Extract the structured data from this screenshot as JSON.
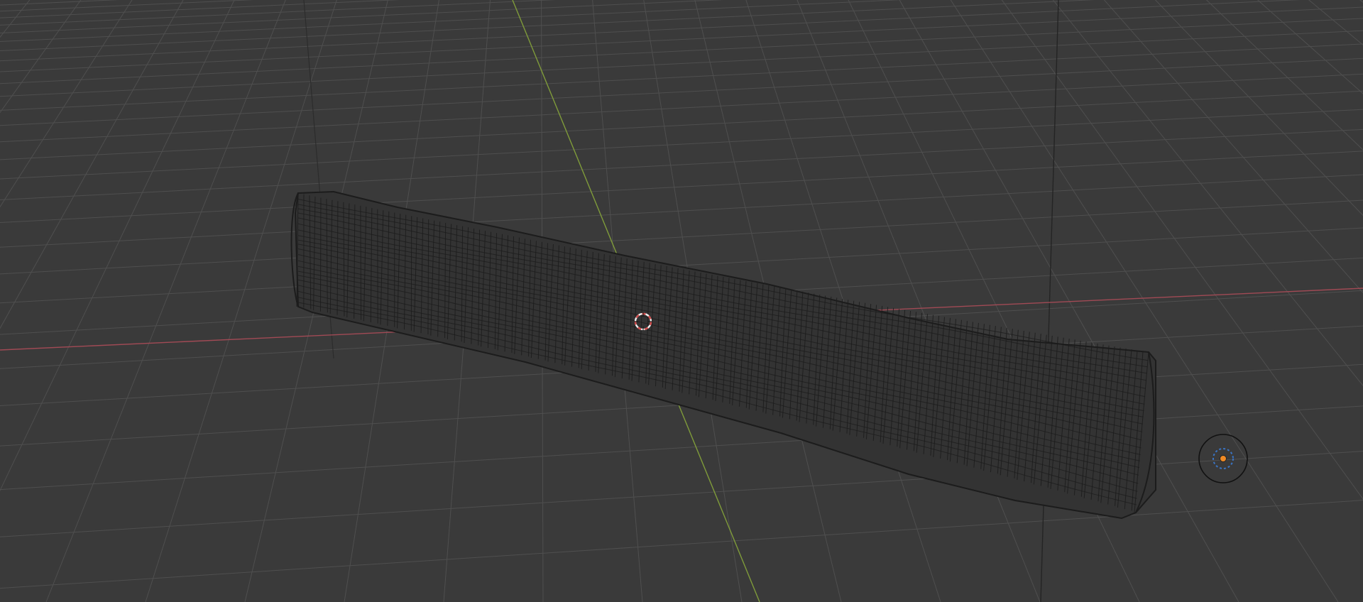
{
  "viewport": {
    "mode": "3D viewport",
    "shading": "wireframe"
  },
  "colors": {
    "background": "#3a3a3a",
    "grid_line": "#4f4f4f",
    "grid_line_major": "#575757",
    "x_axis": "#a14a55",
    "y_axis": "#7f9b3a",
    "mesh_wire": "#1c1c1c",
    "mesh_fill": "#333333",
    "cursor_red": "#d24a4a",
    "cursor_white": "#eeeeee",
    "origin_point": "#f08a24",
    "origin_ring": "#3a74c4",
    "light_outline": "#111111"
  },
  "icons": {
    "3d_cursor": "3d-cursor-icon",
    "light": "point-light-icon",
    "origin": "object-origin-icon"
  }
}
